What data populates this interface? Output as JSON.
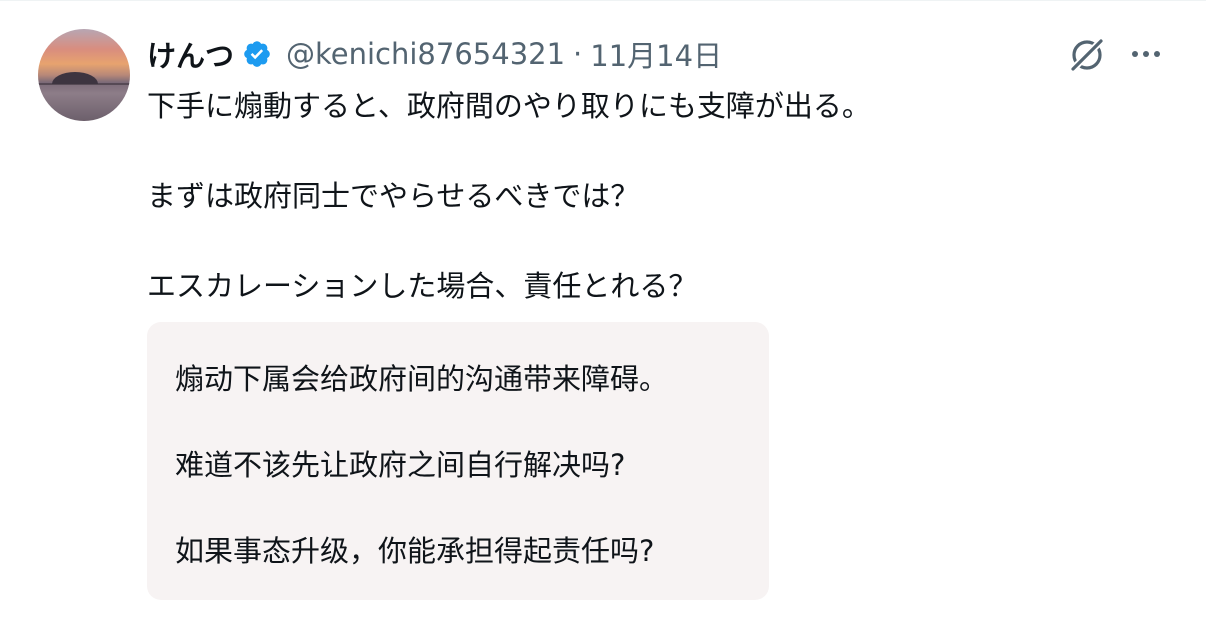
{
  "post": {
    "author": {
      "display_name": "けんつ",
      "verified": true,
      "handle": "@kenichi87654321",
      "separator": "·",
      "date": "11月14日"
    },
    "icons": {
      "verified": "verified-badge-icon",
      "grok": "grok-icon",
      "more": "more-options-icon"
    },
    "text_lines": [
      "下手に煽動すると、政府間のやり取りにも支障が出る。",
      "まずは政府同士でやらせるべきでは？",
      "エスカレーションした場合、責任とれる？"
    ],
    "translation": {
      "lines": [
        "煽动下属会给政府间的沟通带来障碍。",
        "难道不该先让政府之间自行解决吗?",
        "如果事态升级，你能承担得起责任吗?"
      ]
    }
  },
  "colors": {
    "text": "#0f1419",
    "secondary": "#536471",
    "verified": "#1d9bf0",
    "translation_bg": "#f7f3f3"
  }
}
